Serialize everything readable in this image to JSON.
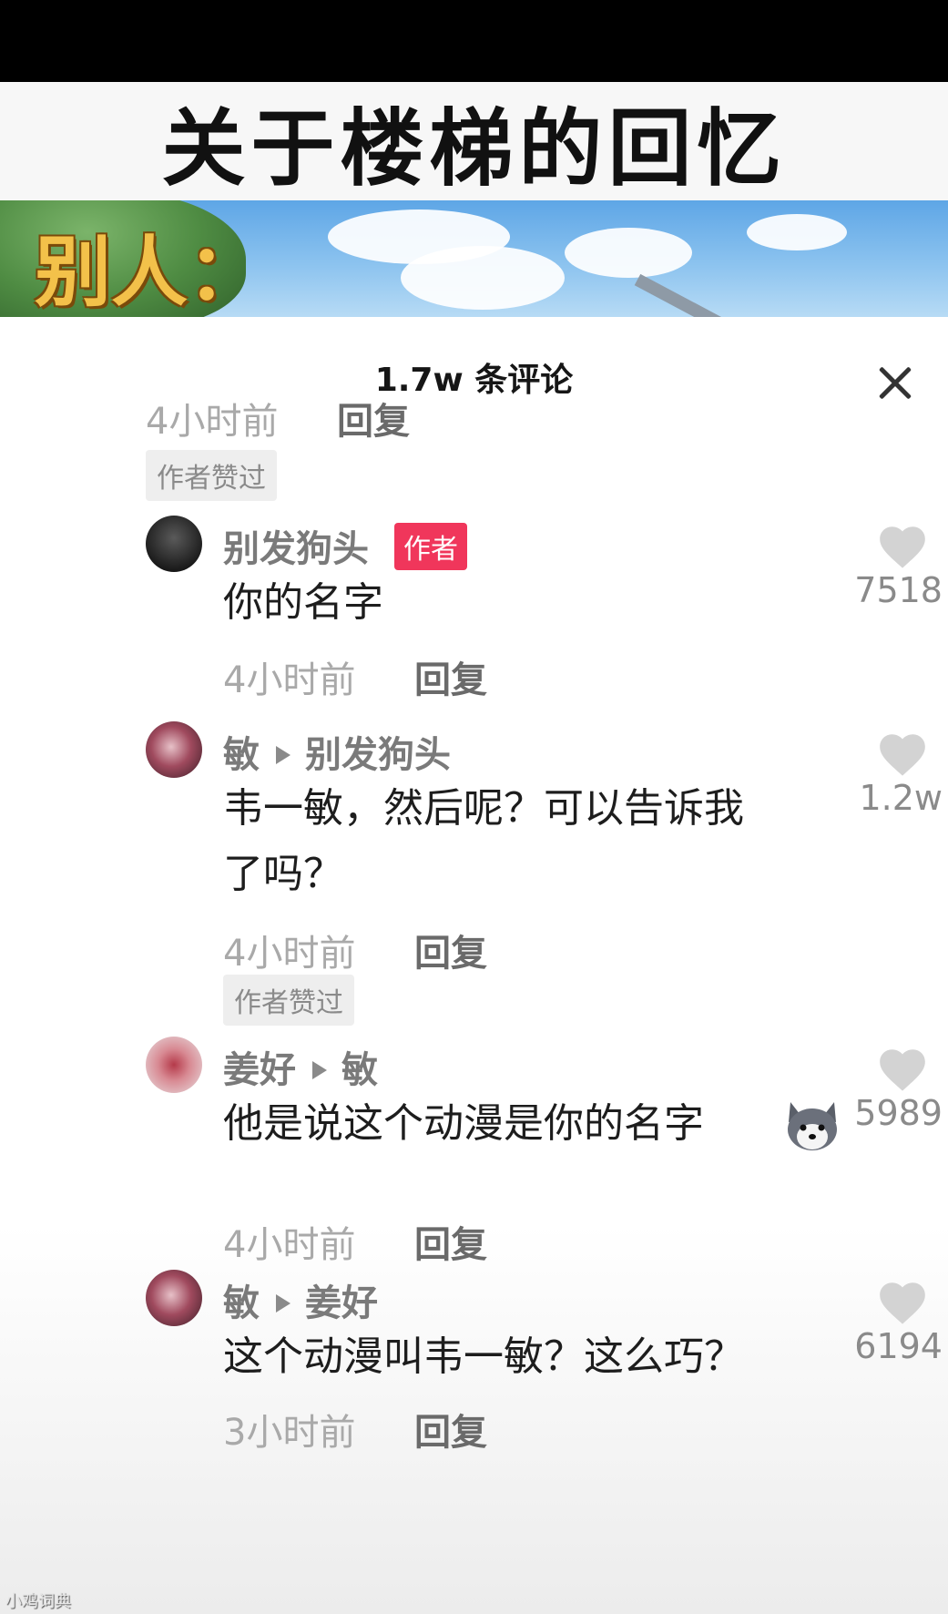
{
  "video": {
    "title": "关于楼梯的回忆",
    "banner_label": "别人："
  },
  "panel": {
    "comment_count": "1.7w 条评论"
  },
  "top_meta": {
    "time": "4小时前",
    "reply": "回复",
    "liked_tag": "作者赞过"
  },
  "comments": [
    {
      "name": "别发狗头",
      "badge": "作者",
      "text": "你的名字",
      "time": "4小时前",
      "reply": "回复",
      "likes": "7518"
    },
    {
      "name": "敏",
      "reply_to": "别发狗头",
      "text_line1": "韦一敏，然后呢？可以告诉我",
      "text_line2": "了吗？",
      "time": "4小时前",
      "reply": "回复",
      "liked_tag": "作者赞过",
      "likes": "1.2w"
    },
    {
      "name": "姜好",
      "reply_to": "敏",
      "text": "他是说这个动漫是你的名字",
      "emoji": "husky-dog-emoji",
      "time": "4小时前",
      "reply": "回复",
      "likes": "5989"
    },
    {
      "name": "敏",
      "reply_to": "姜好",
      "text": "这个动漫叫韦一敏？这么巧？",
      "time": "3小时前",
      "reply": "回复",
      "likes": "6194"
    }
  ],
  "watermark": "小鸡词典",
  "colors": {
    "author_badge": "#f0365b",
    "heart": "#d3d3d3",
    "banner_text": "#f3c14a"
  }
}
